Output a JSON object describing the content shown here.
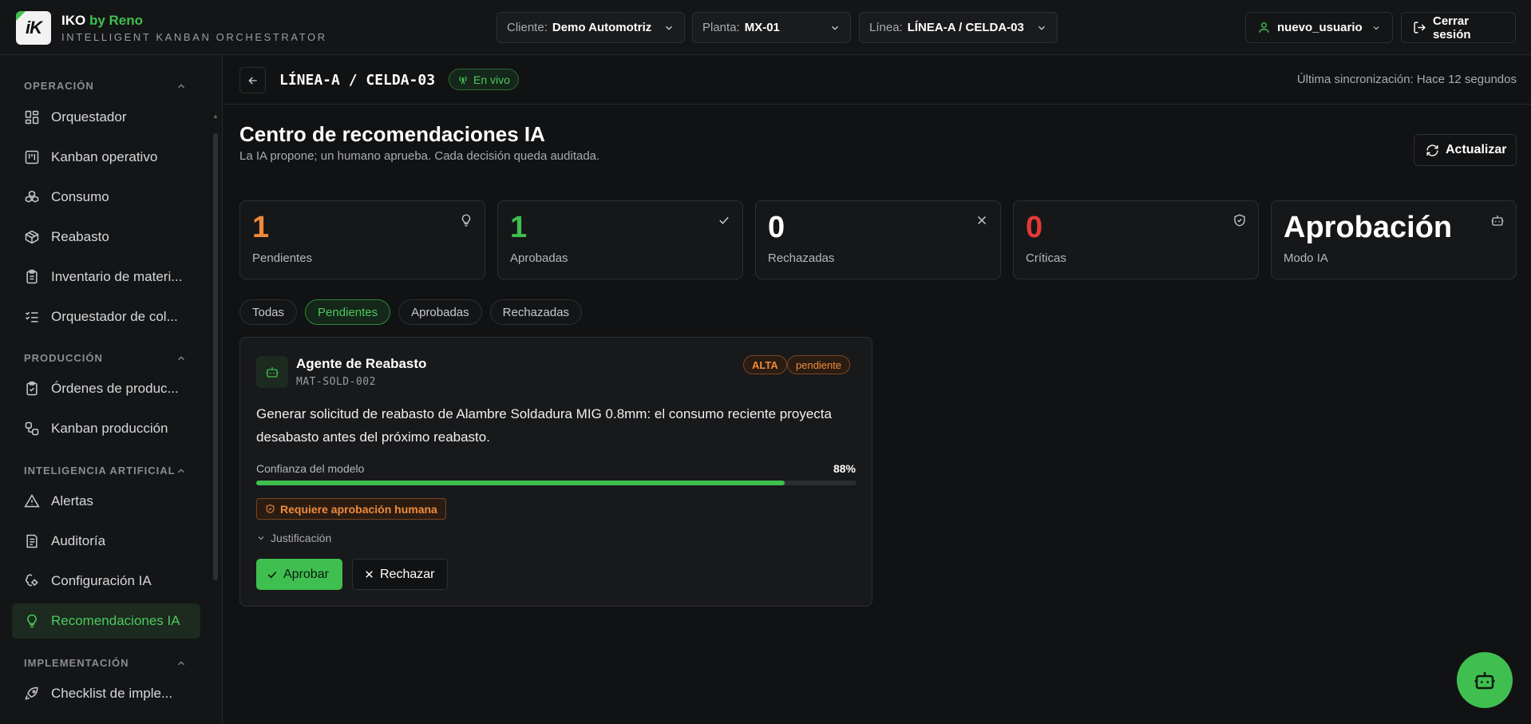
{
  "header": {
    "logo_text": "iK",
    "brand_name": "IKO",
    "brand_by": "by Reno",
    "tagline": "INTELLIGENT KANBAN ORCHESTRATOR",
    "client_label": "Cliente:",
    "client_value": "Demo Automotriz",
    "plant_label": "Planta:",
    "plant_value": "MX-01",
    "line_label": "Línea:",
    "line_value": "LÍNEA-A / CELDA-03",
    "user": "nuevo_usuario",
    "logout": "Cerrar sesión",
    "accent": "#3fbf4f"
  },
  "sidebar": {
    "sections": [
      {
        "label": "OPERACIÓN",
        "items": [
          {
            "label": "Orquestador",
            "icon": "dashboard-icon"
          },
          {
            "label": "Kanban operativo",
            "icon": "kanban-icon"
          },
          {
            "label": "Consumo",
            "icon": "boxes-icon"
          },
          {
            "label": "Reabasto",
            "icon": "package-icon"
          },
          {
            "label": "Inventario de materi...",
            "icon": "clipboard-icon"
          },
          {
            "label": "Orquestador de col...",
            "icon": "list-check-icon"
          }
        ]
      },
      {
        "label": "PRODUCCIÓN",
        "items": [
          {
            "label": "Órdenes de produc...",
            "icon": "clipboard-check-icon"
          },
          {
            "label": "Kanban producción",
            "icon": "workflow-icon"
          }
        ]
      },
      {
        "label": "INTELIGENCIA ARTIFICIAL",
        "items": [
          {
            "label": "Alertas",
            "icon": "alert-icon"
          },
          {
            "label": "Auditoría",
            "icon": "audit-icon"
          },
          {
            "label": "Configuración IA",
            "icon": "brain-cog-icon"
          },
          {
            "label": "Recomendaciones IA",
            "icon": "lightbulb-icon"
          }
        ]
      },
      {
        "label": "IMPLEMENTACIÓN",
        "items": [
          {
            "label": "Checklist de imple...",
            "icon": "rocket-icon"
          }
        ]
      }
    ]
  },
  "subbar": {
    "title": "LÍNEA-A / CELDA-03",
    "live": "En vivo",
    "sync": "Última sincronización: Hace 12 segundos"
  },
  "page": {
    "title": "Centro de recomendaciones IA",
    "subtitle": "La IA propone; un humano aprueba. Cada decisión queda auditada.",
    "refresh": "Actualizar"
  },
  "stats": [
    {
      "value": "1",
      "label": "Pendientes",
      "color": "#f08a3a",
      "icon": "lightbulb-icon"
    },
    {
      "value": "1",
      "label": "Aprobadas",
      "color": "#3fbf4f",
      "icon": "check-icon"
    },
    {
      "value": "0",
      "label": "Rechazadas",
      "color": "#ffffff",
      "icon": "x-icon"
    },
    {
      "value": "0",
      "label": "Críticas",
      "color": "#e53935",
      "icon": "shield-icon"
    },
    {
      "value": "Aprobación",
      "label": "Modo IA",
      "color": "#ffffff",
      "icon": "bot-icon"
    }
  ],
  "filters": [
    "Todas",
    "Pendientes",
    "Aprobadas",
    "Rechazadas"
  ],
  "active_filter": "Pendientes",
  "recommendation": {
    "agent": "Agente de Reabasto",
    "code": "MAT-SOLD-002",
    "priority": "ALTA",
    "status": "pendiente",
    "description": "Generar solicitud de reabasto de Alambre Soldadura MIG 0.8mm: el consumo reciente proyecta desabasto antes del próximo reabasto.",
    "confidence_label": "Confianza del modelo",
    "confidence_text": "88%",
    "confidence": 0.88,
    "requires": "Requiere aprobación humana",
    "justification": "Justificación",
    "approve": "Aprobar",
    "reject": "Rechazar"
  }
}
